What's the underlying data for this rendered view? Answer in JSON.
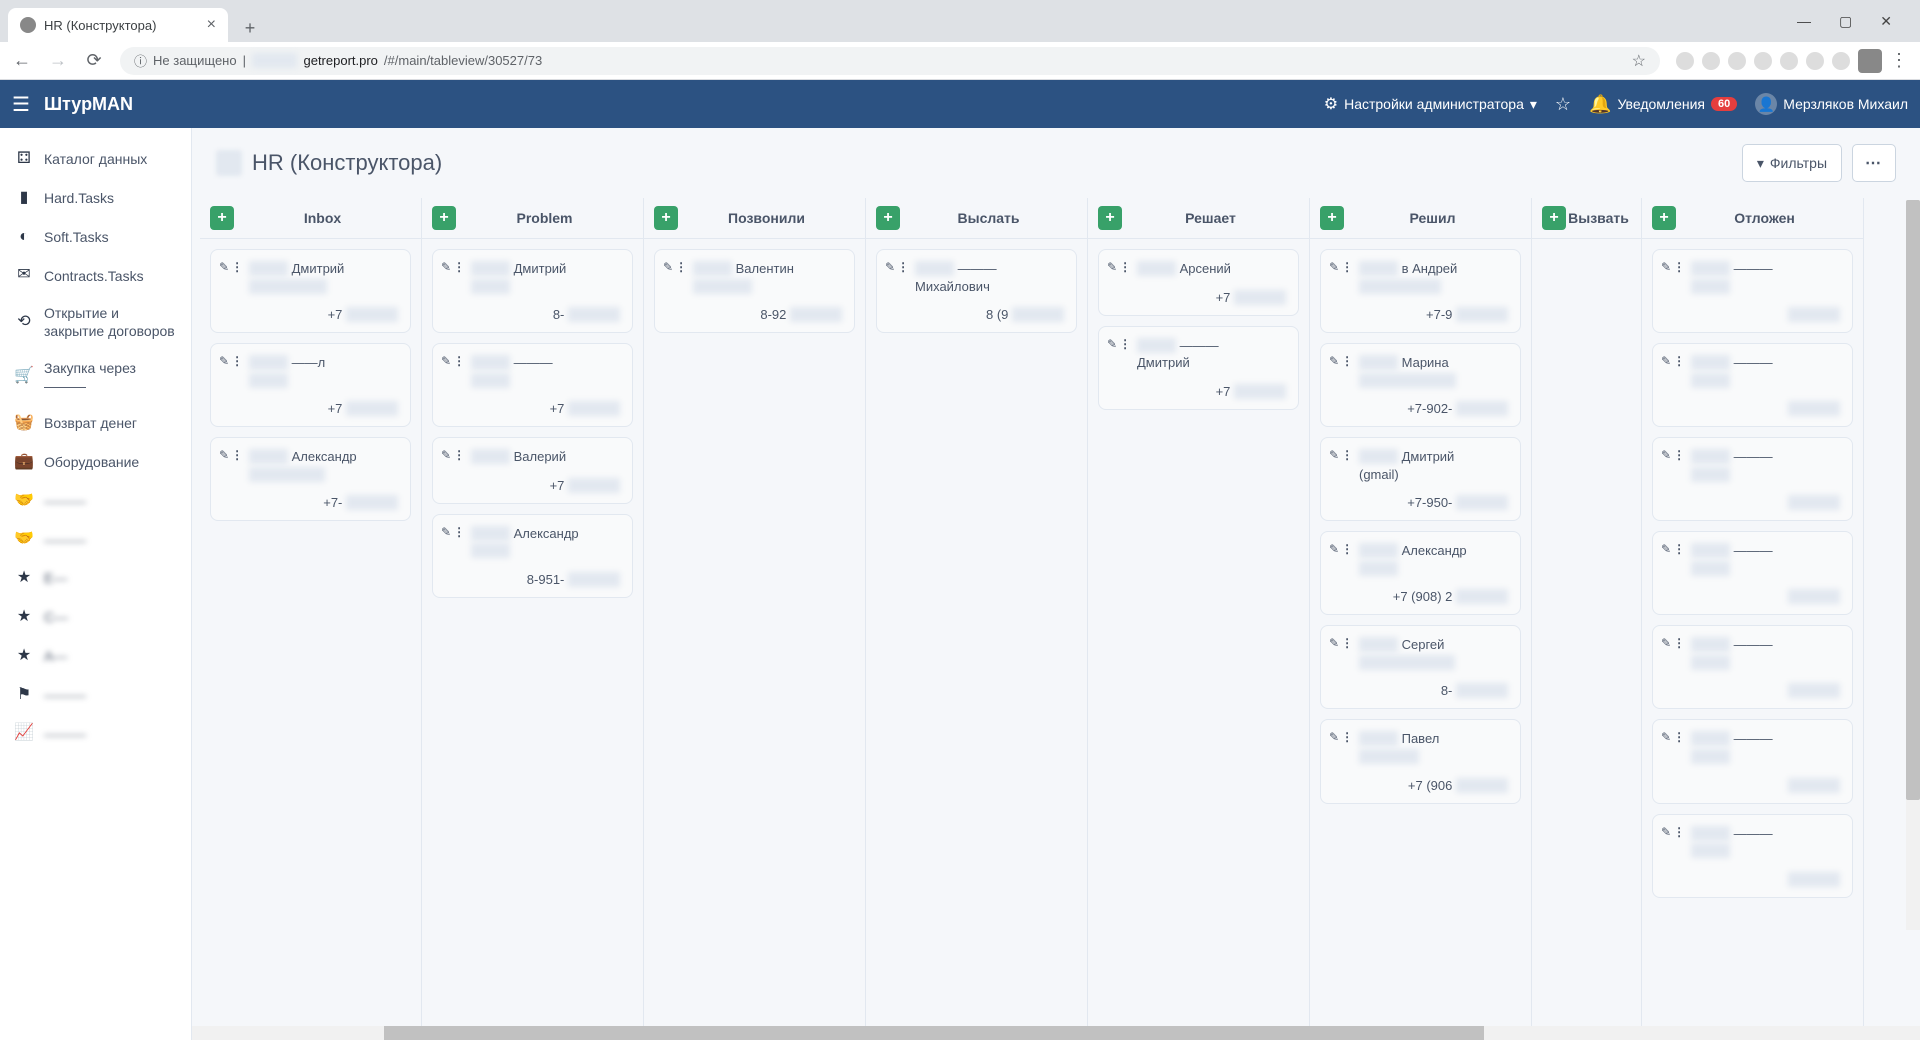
{
  "browser": {
    "tab_title": "HR (Конструктора)",
    "url_prefix": "Не защищено",
    "url_domain": "getreport.pro",
    "url_path": "/#/main/tableview/30527/73"
  },
  "app": {
    "name": "ШтурMAN",
    "admin_settings": "Настройки администратора",
    "notifications_label": "Уведомления",
    "notifications_count": "60",
    "user_name": "Мерзляков Михаил"
  },
  "sidebar": {
    "items": [
      {
        "icon": "sitemap",
        "label": "Каталог данных",
        "blurred": false
      },
      {
        "icon": "books",
        "label": "Hard.Tasks",
        "blurred": false
      },
      {
        "icon": "circle",
        "label": "Soft.Tasks",
        "blurred": false
      },
      {
        "icon": "mail",
        "label": "Contracts.Tasks",
        "blurred": false
      },
      {
        "icon": "box",
        "label": "Открытие и закрытие договоров",
        "blurred": false
      },
      {
        "icon": "cart",
        "label": "Закупка через\n———",
        "blurred": false
      },
      {
        "icon": "basket",
        "label": "Возврат денег",
        "blurred": false
      },
      {
        "icon": "briefcase",
        "label": "Оборудование",
        "blurred": false
      },
      {
        "icon": "handshake",
        "label": "———",
        "blurred": true
      },
      {
        "icon": "handshake",
        "label": "———",
        "blurred": true
      },
      {
        "icon": "star",
        "label": "E—",
        "blurred": true
      },
      {
        "icon": "star",
        "label": "C—",
        "blurred": true
      },
      {
        "icon": "star",
        "label": "A—",
        "blurred": true
      },
      {
        "icon": "flag",
        "label": "———",
        "blurred": true
      },
      {
        "icon": "chart",
        "label": "———",
        "blurred": true
      }
    ]
  },
  "page": {
    "title": "HR (Конструктора)",
    "filter_label": "Фильтры"
  },
  "board": {
    "columns": [
      {
        "title": "Inbox",
        "cards": [
          {
            "name_prefix": "",
            "name_visible": "Дмитрий",
            "name_suffix": "——————",
            "phone_prefix": "+7",
            "phone_blur": "— — — —"
          },
          {
            "name_prefix": "",
            "name_visible": "——л",
            "name_suffix": "———",
            "phone_prefix": "+7",
            "phone_blur": "— — — —"
          },
          {
            "name_prefix": "",
            "name_visible": "Александр",
            "name_suffix": "——ч (gmail)",
            "phone_prefix": "+7-",
            "phone_blur": "— — — —"
          }
        ]
      },
      {
        "title": "Problem",
        "cards": [
          {
            "name_prefix": "",
            "name_visible": "Дмитрий",
            "name_suffix": "———",
            "phone_prefix": "8-",
            "phone_blur": "— — — —"
          },
          {
            "name_prefix": "",
            "name_visible": "———",
            "name_suffix": "———",
            "phone_prefix": "+7",
            "phone_blur": "— — — —"
          },
          {
            "name_prefix": "",
            "name_visible": "Валерий",
            "name_suffix": "",
            "phone_prefix": "+7",
            "phone_blur": "— — — —"
          },
          {
            "name_prefix": "",
            "name_visible": "Александр",
            "name_suffix": "———",
            "phone_prefix": "8-951-",
            "phone_blur": "— — "
          }
        ]
      },
      {
        "title": "Позвонили",
        "cards": [
          {
            "name_prefix": "",
            "name_visible": "Валентин",
            "name_suffix": "————ч",
            "phone_prefix": "8-92",
            "phone_blur": "— — —"
          }
        ]
      },
      {
        "title": "Выслать",
        "cards": [
          {
            "name_prefix": "",
            "name_visible": "———",
            "name_suffix": "Михайлович",
            "phone_prefix": "8 (9",
            "phone_blur": "— — —"
          }
        ]
      },
      {
        "title": "Решает",
        "cards": [
          {
            "name_prefix": "",
            "name_visible": "Арсений",
            "name_suffix": "",
            "phone_prefix": "+7",
            "phone_blur": "— — — —"
          },
          {
            "name_prefix": "",
            "name_visible": "———",
            "name_suffix": "Дмитрий",
            "phone_prefix": "+7",
            "phone_blur": "— — — —"
          }
        ]
      },
      {
        "title": "Решил",
        "cards": [
          {
            "name_prefix": "",
            "name_visible": "в Андрей",
            "name_suffix": "——— (gmail)",
            "phone_prefix": "+7-9",
            "phone_blur": "— — —"
          },
          {
            "name_prefix": "",
            "name_visible": "Марина",
            "name_suffix": "———на (gmail)",
            "phone_prefix": "+7-902-",
            "phone_blur": "— —"
          },
          {
            "name_prefix": "",
            "name_visible": "Дмитрий",
            "name_suffix": "(gmail)",
            "phone_prefix": "+7-950-",
            "phone_blur": "— —"
          },
          {
            "name_prefix": "",
            "name_visible": "Александр",
            "name_suffix": "———",
            "phone_prefix": "+7 (908) 2",
            "phone_blur": "— —"
          },
          {
            "name_prefix": "",
            "name_visible": "Сергей",
            "name_suffix": "———ич (gmail)",
            "phone_prefix": "8-",
            "phone_blur": "— — —"
          },
          {
            "name_prefix": "",
            "name_visible": "Павел",
            "name_suffix": "———вич",
            "phone_prefix": "+7 (906",
            "phone_blur": "— —"
          }
        ]
      },
      {
        "title": "Вызвать",
        "narrow": true,
        "cards": []
      },
      {
        "title": "Отложен",
        "cards": [
          {
            "name_prefix": "",
            "name_visible": "———",
            "name_suffix": "———",
            "phone_prefix": "",
            "phone_blur": "— — — —"
          },
          {
            "name_prefix": "",
            "name_visible": "———",
            "name_suffix": "———",
            "phone_prefix": "",
            "phone_blur": "— — — —"
          },
          {
            "name_prefix": "",
            "name_visible": "———",
            "name_suffix": "———",
            "phone_prefix": "",
            "phone_blur": "— — — —"
          },
          {
            "name_prefix": "",
            "name_visible": "———",
            "name_suffix": "———",
            "phone_prefix": "",
            "phone_blur": "— — — —"
          },
          {
            "name_prefix": "",
            "name_visible": "———",
            "name_suffix": "———",
            "phone_prefix": "",
            "phone_blur": "— — — —"
          },
          {
            "name_prefix": "",
            "name_visible": "———",
            "name_suffix": "———",
            "phone_prefix": "",
            "phone_blur": "— — — —"
          },
          {
            "name_prefix": "",
            "name_visible": "———",
            "name_suffix": "———",
            "phone_prefix": "",
            "phone_blur": "— — — —"
          }
        ]
      }
    ]
  },
  "icons": {
    "sitemap": "⚃",
    "books": "▮",
    "circle": "◐",
    "mail": "✉",
    "box": "⟲",
    "cart": "🛒",
    "basket": "🧺",
    "briefcase": "💼",
    "handshake": "🤝",
    "star": "★",
    "flag": "⚑",
    "chart": "📈",
    "filter": "▼",
    "gear": "⚙",
    "bell": "🔔",
    "edit": "✎",
    "more": "⋮",
    "plus": "+"
  }
}
